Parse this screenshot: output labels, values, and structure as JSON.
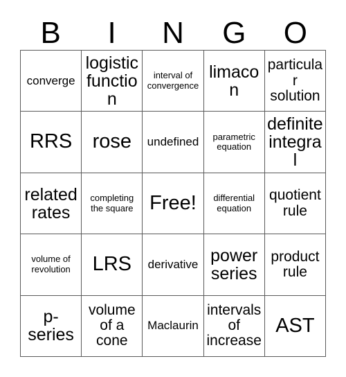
{
  "card": {
    "title_letters": [
      "B",
      "I",
      "N",
      "G",
      "O"
    ],
    "free_space_label": "Free!",
    "rows": [
      [
        {
          "text": "converge",
          "size": "sm"
        },
        {
          "text": "logistic function",
          "size": "lg"
        },
        {
          "text": "interval of convergence",
          "size": "xs"
        },
        {
          "text": "limacon",
          "size": "lg"
        },
        {
          "text": "particular solution",
          "size": "md"
        }
      ],
      [
        {
          "text": "RRS",
          "size": "xl"
        },
        {
          "text": "rose",
          "size": "xl"
        },
        {
          "text": "undefined",
          "size": "sm"
        },
        {
          "text": "parametric equation",
          "size": "xs"
        },
        {
          "text": "definite integral",
          "size": "lg"
        }
      ],
      [
        {
          "text": "related rates",
          "size": "lg"
        },
        {
          "text": "completing the square",
          "size": "xs"
        },
        {
          "text": "Free!",
          "size": "xl"
        },
        {
          "text": "differential equation",
          "size": "xs"
        },
        {
          "text": "quotient rule",
          "size": "md"
        }
      ],
      [
        {
          "text": "volume of revolution",
          "size": "xs"
        },
        {
          "text": "LRS",
          "size": "xl"
        },
        {
          "text": "derivative",
          "size": "sm"
        },
        {
          "text": "power series",
          "size": "lg"
        },
        {
          "text": "product rule",
          "size": "md"
        }
      ],
      [
        {
          "text": "p-series",
          "size": "lg"
        },
        {
          "text": "volume of a cone",
          "size": "md"
        },
        {
          "text": "Maclaurin",
          "size": "sm"
        },
        {
          "text": "intervals of increase",
          "size": "md"
        },
        {
          "text": "AST",
          "size": "xl"
        }
      ]
    ]
  },
  "colors": {
    "background": "#ffffff",
    "text": "#000000",
    "grid_line": "#5a5a5a"
  }
}
